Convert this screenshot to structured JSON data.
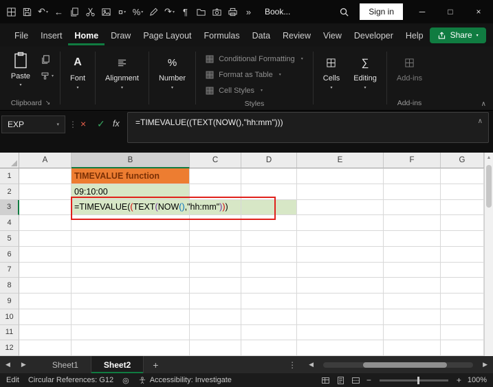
{
  "colors": {
    "accent_green": "#107C41",
    "highlight_red": "#E0201B",
    "cell_orange": "#ED7D31",
    "cell_green": "#D7E7C6"
  },
  "icons": {
    "caret_down": "▾",
    "collapse_up": "∧",
    "cancel": "×",
    "enter": "✓",
    "dots_vertical": "⋮",
    "nav_left": "◀",
    "nav_right": "▶",
    "scroll_up": "▲",
    "dialog_launcher": "↘",
    "record": "◎",
    "minus": "−",
    "plus": "+"
  },
  "titlebar": {
    "qat": [
      {
        "name": "app-icon",
        "glyph": "▦"
      },
      {
        "name": "save-icon",
        "glyph": "▣"
      },
      {
        "name": "undo-icon",
        "glyph": "↶",
        "caret": true
      },
      {
        "name": "back-icon",
        "glyph": "←"
      },
      {
        "name": "copy-icon",
        "glyph": "⊞"
      },
      {
        "name": "cut-icon",
        "glyph": "✂"
      },
      {
        "name": "image-icon",
        "glyph": "▤"
      },
      {
        "name": "currency-icon",
        "glyph": "¤",
        "caret": true
      },
      {
        "name": "percent-icon",
        "glyph": "%",
        "caret": true
      },
      {
        "name": "pencil-icon",
        "glyph": "✎"
      },
      {
        "name": "redo-icon",
        "glyph": "↷",
        "caret": true
      },
      {
        "name": "paragraph-icon",
        "glyph": "¶"
      },
      {
        "name": "folder-icon",
        "glyph": "⊟"
      },
      {
        "name": "camera-icon",
        "glyph": "◉"
      },
      {
        "name": "printer-icon",
        "glyph": "⊡"
      },
      {
        "name": "more-commands-icon",
        "glyph": "»"
      }
    ],
    "title": "Book...",
    "sign_in": "Sign in",
    "window": {
      "minimize": "─",
      "maximize": "□",
      "close": "×"
    }
  },
  "menu": {
    "tabs": [
      {
        "label": "File"
      },
      {
        "label": "Insert"
      },
      {
        "label": "Home",
        "active": true
      },
      {
        "label": "Draw"
      },
      {
        "label": "Page Layout"
      },
      {
        "label": "Formulas"
      },
      {
        "label": "Data"
      },
      {
        "label": "Review"
      },
      {
        "label": "View"
      },
      {
        "label": "Developer"
      },
      {
        "label": "Help"
      }
    ],
    "share_label": "Share"
  },
  "ribbon": {
    "paste": {
      "label": "Paste"
    },
    "clipboard_group_label": "Clipboard",
    "groups_left": [
      {
        "name": "font",
        "label": "Font",
        "glyph": "A"
      },
      {
        "name": "alignment",
        "label": "Alignment",
        "glyph": "≡"
      },
      {
        "name": "number",
        "label": "Number",
        "glyph": "%"
      }
    ],
    "styles": {
      "group_label": "Styles",
      "items": [
        {
          "label": "Conditional Formatting"
        },
        {
          "label": "Format as Table"
        },
        {
          "label": "Cell Styles"
        }
      ]
    },
    "groups_right": [
      {
        "name": "cells",
        "label": "Cells",
        "glyph": "▦"
      },
      {
        "name": "editing",
        "label": "Editing",
        "glyph": "∑"
      }
    ],
    "addins": {
      "label": "Add-ins",
      "group_label": "Add-ins",
      "glyph": "⊞"
    }
  },
  "formula_bar": {
    "name_box": "EXP",
    "fx_label": "fx",
    "formula": "=TIMEVALUE((TEXT(NOW(),\"hh:mm\")))"
  },
  "grid": {
    "columns": [
      "A",
      "B",
      "C",
      "D",
      "E",
      "F",
      "G"
    ],
    "rows": [
      "1",
      "2",
      "3",
      "4",
      "5",
      "6",
      "7",
      "8",
      "9",
      "10",
      "11",
      "12"
    ],
    "selected": {
      "column": "B",
      "row": "3"
    },
    "cells": [
      {
        "ref": "B1",
        "text": "TIMEVALUE function",
        "bg": "#ED7D31",
        "color": "#7B3005",
        "bold": true
      },
      {
        "ref": "B2",
        "text": "09:10:00",
        "bg": "#D7E7C6",
        "color": "#000000"
      },
      {
        "ref": "B3",
        "bg": "#D7E7C6",
        "formula": true
      },
      {
        "ref": "C3",
        "bg": "#D7E7C6"
      },
      {
        "ref": "D3",
        "bg": "#D7E7C6"
      }
    ],
    "formula_parts": [
      {
        "t": "=TIMEVALUE",
        "c": "#000000"
      },
      {
        "t": "(",
        "c": "#000000"
      },
      {
        "t": "(",
        "c": "#D60000"
      },
      {
        "t": "TEXT",
        "c": "#000000"
      },
      {
        "t": "(",
        "c": "#7030A0"
      },
      {
        "t": "NOW",
        "c": "#000000"
      },
      {
        "t": "(",
        "c": "#0070C0"
      },
      {
        "t": ")",
        "c": "#0070C0"
      },
      {
        "t": ",",
        "c": "#000000"
      },
      {
        "t": "\"hh:mm\"",
        "c": "#000000"
      },
      {
        "t": ")",
        "c": "#7030A0"
      },
      {
        "t": ")",
        "c": "#D60000"
      },
      {
        "t": ")",
        "c": "#000000"
      }
    ]
  },
  "sheetbar": {
    "tabs": [
      {
        "label": "Sheet1"
      },
      {
        "label": "Sheet2",
        "active": true
      }
    ],
    "add_label": "+"
  },
  "statusbar": {
    "mode": "Edit",
    "circular": "Circular References: G12",
    "accessibility": "Accessibility: Investigate",
    "zoom": "100%"
  }
}
